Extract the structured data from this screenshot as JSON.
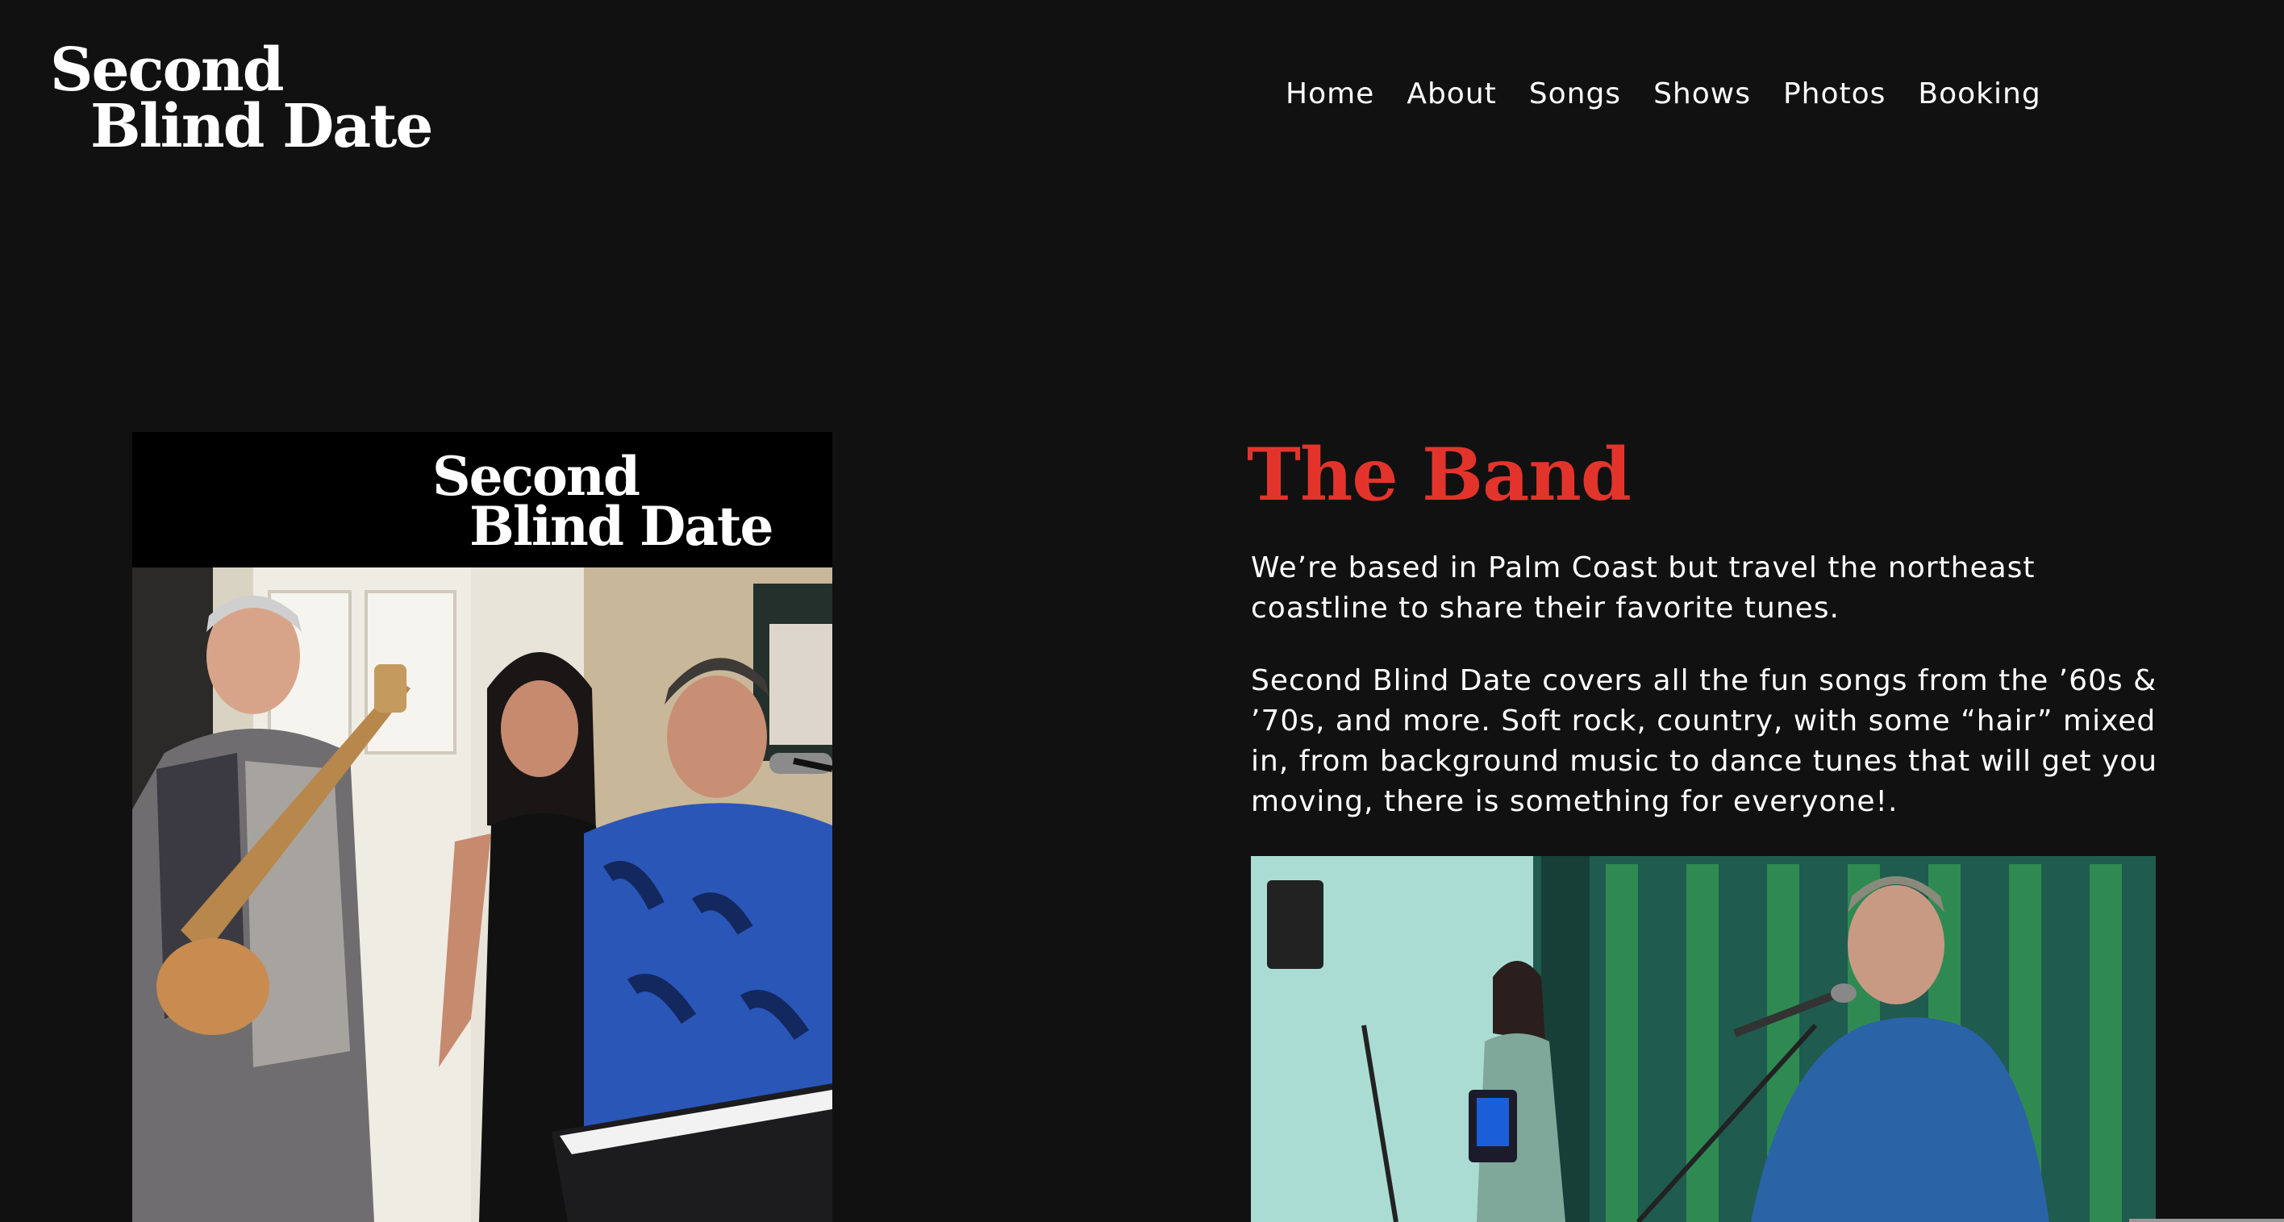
{
  "header": {
    "logo_line1": "Second",
    "logo_line2": "Blind Date",
    "nav": [
      "Home",
      "About",
      "Songs",
      "Shows",
      "Photos",
      "Booking"
    ]
  },
  "band_photo": {
    "logo_line1": "Second",
    "logo_line2": "Blind Date"
  },
  "main": {
    "title": "The Band",
    "paragraph1": "We’re based in Palm Coast but travel the northeast coastline to share their favorite tunes.",
    "paragraph2": "Second Blind Date covers all the fun songs from the ’60s & ’70s, and more. Soft rock, country, with some “hair” mixed in, from background music to dance tunes that will get you moving, there is something for everyone!."
  },
  "colors": {
    "background": "#111111",
    "accent": "#e3342c",
    "text": "#ffffff"
  }
}
